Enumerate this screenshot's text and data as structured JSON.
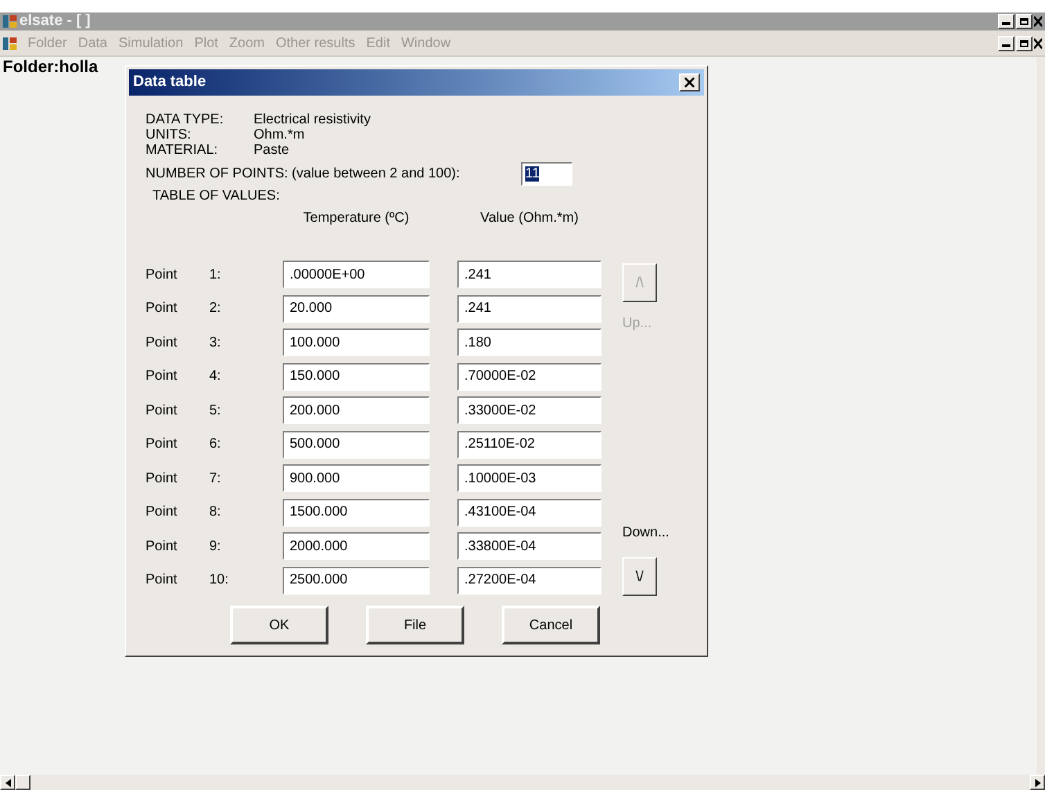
{
  "window": {
    "title": "elsate - [ ]",
    "active": false
  },
  "menu": [
    "Folder",
    "Data",
    "Simulation",
    "Plot",
    "Zoom",
    "Other results",
    "Edit",
    "Window"
  ],
  "folder_label": "Folder:holla",
  "dialog": {
    "title": "Data table",
    "info": [
      {
        "label": "DATA TYPE:",
        "value": "Electrical resistivity"
      },
      {
        "label": "UNITS:",
        "value": "Ohm.*m"
      },
      {
        "label": "MATERIAL:",
        "value": "Paste"
      }
    ],
    "points_label": "NUMBER OF POINTS: (value between 2 and 100):",
    "points_value": "11",
    "points_selected": true,
    "table_label": "TABLE OF VALUES:",
    "columns": [
      "Temperature (ºC)",
      "Value (Ohm.*m)"
    ],
    "rows": [
      {
        "label": "Point",
        "index": "1:",
        "temperature": ".00000E+00",
        "value": ".241"
      },
      {
        "label": "Point",
        "index": "2:",
        "temperature": "20.000",
        "value": ".241"
      },
      {
        "label": "Point",
        "index": "3:",
        "temperature": "100.000",
        "value": ".180"
      },
      {
        "label": "Point",
        "index": "4:",
        "temperature": "150.000",
        "value": ".70000E-02"
      },
      {
        "label": "Point",
        "index": "5:",
        "temperature": "200.000",
        "value": ".33000E-02"
      },
      {
        "label": "Point",
        "index": "6:",
        "temperature": "500.000",
        "value": ".25110E-02"
      },
      {
        "label": "Point",
        "index": "7:",
        "temperature": "900.000",
        "value": ".10000E-03"
      },
      {
        "label": "Point",
        "index": "8:",
        "temperature": "1500.000",
        "value": ".43100E-04"
      },
      {
        "label": "Point",
        "index": "9:",
        "temperature": "2000.000",
        "value": ".33800E-04"
      },
      {
        "label": "Point",
        "index": "10:",
        "temperature": "2500.000",
        "value": ".27200E-04"
      }
    ],
    "up": {
      "symbol": "/\\",
      "label": "Up...",
      "disabled": true
    },
    "down": {
      "symbol": "\\/",
      "label": "Down...",
      "disabled": false
    },
    "buttons": [
      "OK",
      "File",
      "Cancel"
    ]
  }
}
